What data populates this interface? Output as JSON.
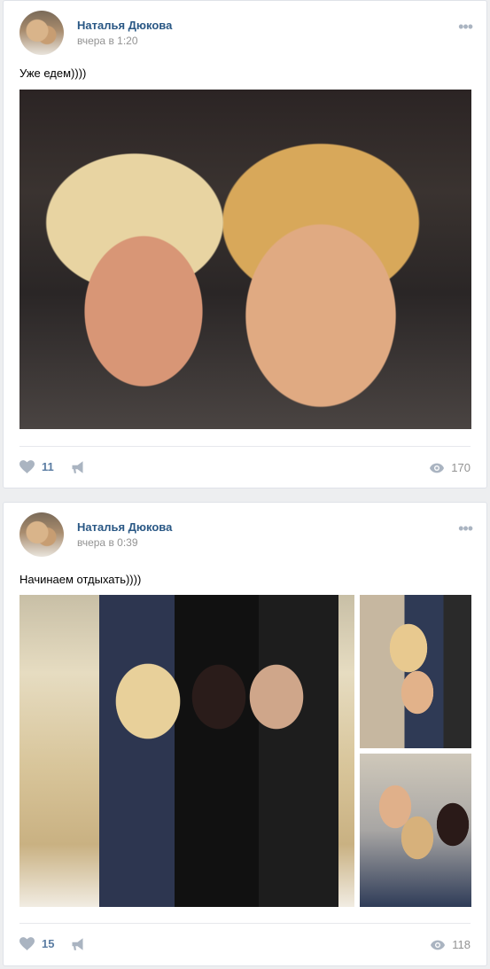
{
  "posts": [
    {
      "author": "Наталья Дюкова",
      "time": "вчера в 1:20",
      "text": "Уже едем))))",
      "likes": "11",
      "views": "170"
    },
    {
      "author": "Наталья Дюкова",
      "time": "вчера в 0:39",
      "text": "Начинаем отдыхать))))",
      "likes": "15",
      "views": "118"
    }
  ],
  "colors": {
    "link": "#2a5885",
    "like_count": "#5b7da3",
    "muted": "#939393",
    "icon": "#aab4c1",
    "background": "#edeef0"
  },
  "icons": [
    "more-icon",
    "heart-icon",
    "share-icon",
    "eye-icon"
  ]
}
